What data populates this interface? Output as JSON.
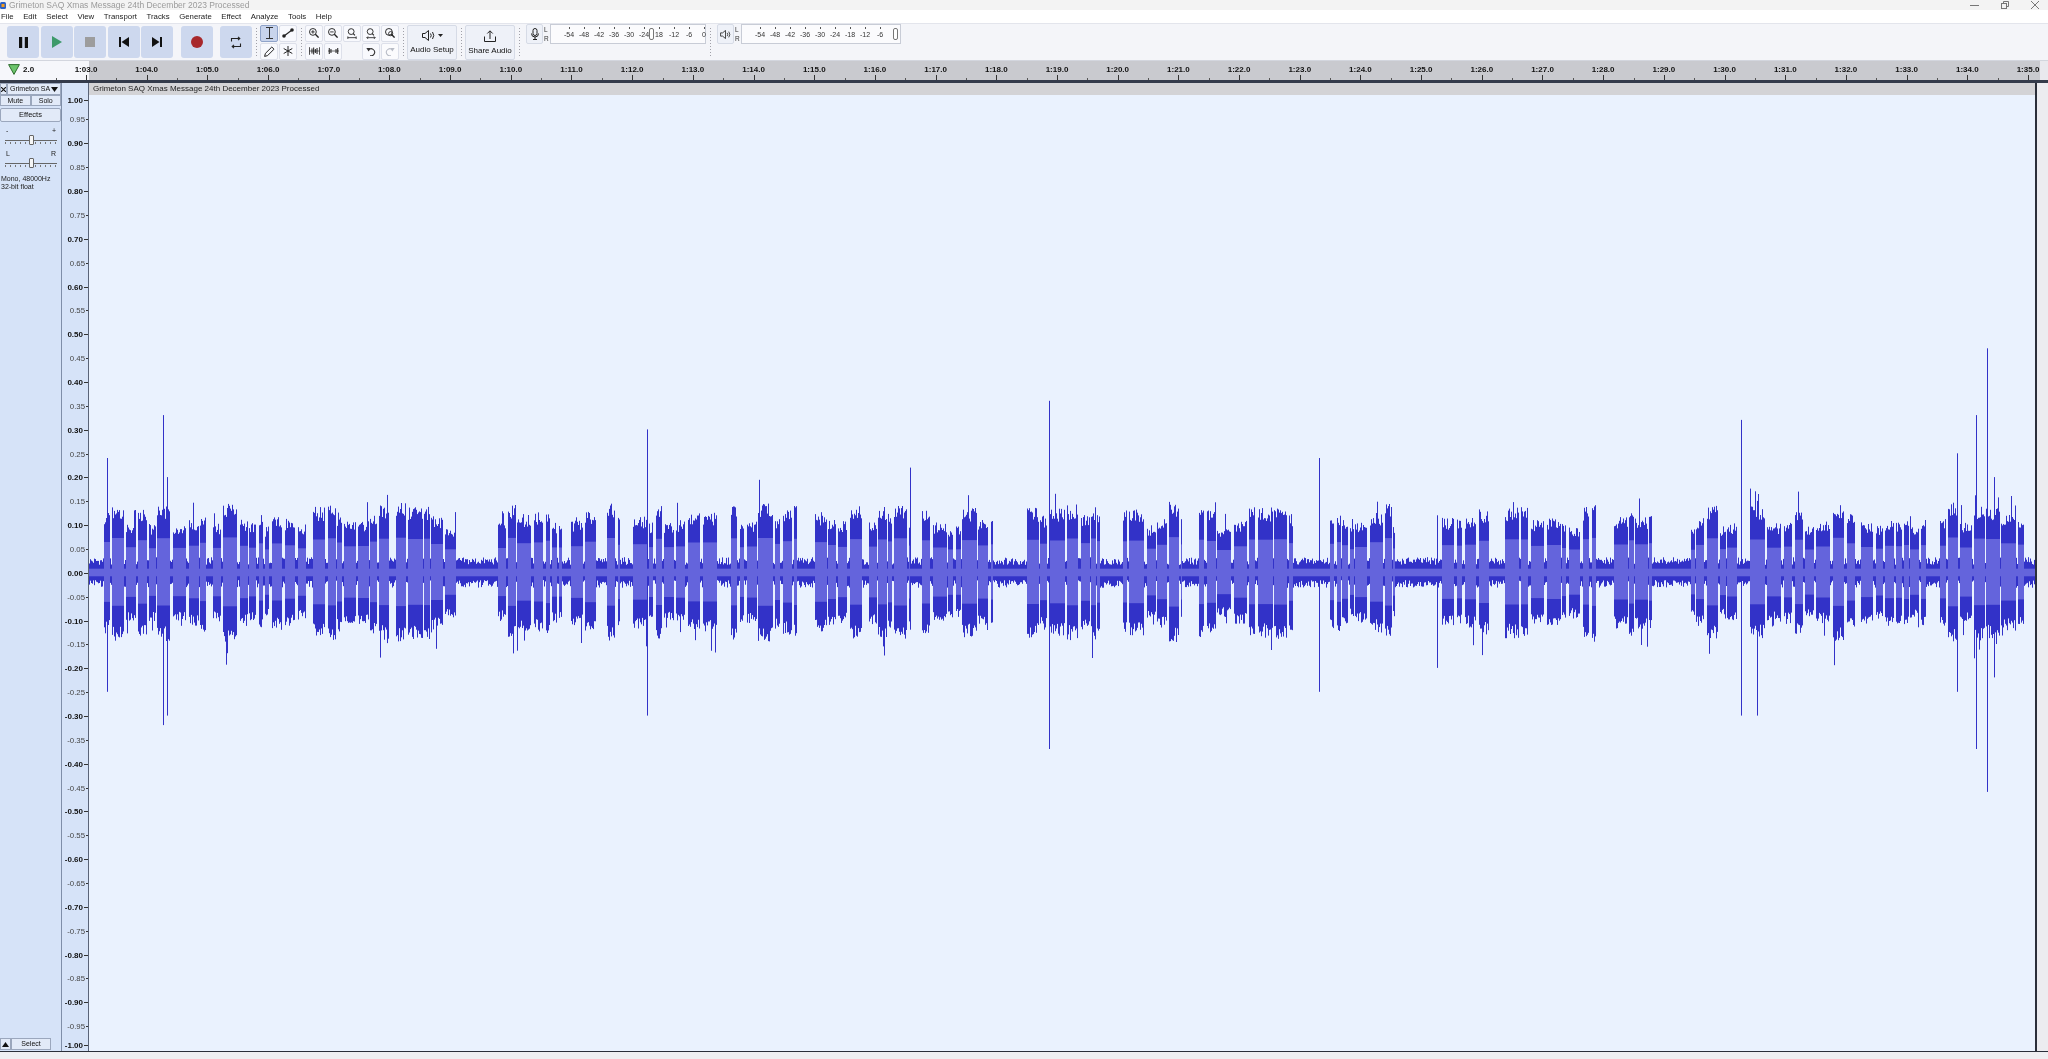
{
  "window": {
    "title": "Grimeton SAQ Xmas Message 24th December 2023 Processed"
  },
  "menu": [
    "File",
    "Edit",
    "Select",
    "View",
    "Transport",
    "Tracks",
    "Generate",
    "Effect",
    "Analyze",
    "Tools",
    "Help"
  ],
  "transport": [
    {
      "kind": "pause"
    },
    {
      "kind": "play"
    },
    {
      "kind": "stop"
    },
    {
      "kind": "skip_start"
    },
    {
      "kind": "skip_end"
    },
    {
      "kind": "record"
    },
    {
      "kind": "loop"
    }
  ],
  "tools": [
    {
      "kind": "select",
      "selected": true
    },
    {
      "kind": "envelope",
      "selected": false
    },
    {
      "kind": "draw",
      "selected": false
    },
    {
      "kind": "multi",
      "selected": false
    }
  ],
  "zoom_tools": [
    {
      "kind": "zoom_in"
    },
    {
      "kind": "zoom_out"
    },
    {
      "kind": "fit_selection"
    },
    {
      "kind": "fit_project"
    },
    {
      "kind": "zoom_toggle"
    }
  ],
  "edit_tools": [
    {
      "kind": "trim"
    },
    {
      "kind": "silence"
    }
  ],
  "history": [
    {
      "kind": "undo",
      "disabled": false
    },
    {
      "kind": "redo",
      "disabled": true
    }
  ],
  "audio_setup": {
    "label": "Audio Setup"
  },
  "share_audio": {
    "label": "Share Audio"
  },
  "recording_meter": {
    "channels": [
      "L",
      "R"
    ],
    "scale": [
      "-54",
      "-48",
      "-42",
      "-36",
      "-30",
      "-24",
      "18",
      "-12",
      "-6",
      "0"
    ],
    "level": 0.65
  },
  "playback_meter": {
    "channels": [
      "L",
      "R"
    ],
    "scale": [
      "-54",
      "-48",
      "-42",
      "-36",
      "-30",
      "-24",
      "-18",
      "-12",
      "-6"
    ],
    "level": 1.0
  },
  "timeline": {
    "labels": [
      "2.0",
      "1:03.0",
      "1:04.0",
      "1:05.0",
      "1:06.0",
      "1:07.0",
      "1:08.0",
      "1:09.0",
      "1:10.0",
      "1:11.0",
      "1:12.0",
      "1:13.0",
      "1:14.0",
      "1:15.0",
      "1:16.0",
      "1:17.0",
      "1:18.0",
      "1:19.0",
      "1:20.0",
      "1:21.0",
      "1:22.0",
      "1:23.0",
      "1:24.0",
      "1:25.0",
      "1:26.0",
      "1:27.0",
      "1:28.0",
      "1:29.0",
      "1:30.0",
      "1:31.0",
      "1:32.0",
      "1:33.0",
      "1:34.0",
      "1:35.0"
    ]
  },
  "track": {
    "name": "Grimeton SA",
    "mute": {
      "label": "Mute",
      "on": false
    },
    "solo": {
      "label": "Solo",
      "on": false
    },
    "effects": "Effects",
    "gain": {
      "min_label": "-",
      "max_label": "+",
      "level": 0.5
    },
    "pan": {
      "left_label": "L",
      "right_label": "R",
      "level": 0.5
    },
    "format": "Mono, 48000Hz",
    "sample_format": "32-bit float",
    "select": "Select"
  },
  "vertical_ruler": [
    "1.00",
    "0.95",
    "0.90",
    "0.85",
    "0.80",
    "0.75",
    "0.70",
    "0.65",
    "0.60",
    "0.55",
    "0.50",
    "0.45",
    "0.40",
    "0.35",
    "0.30",
    "0.25",
    "0.20",
    "0.15",
    "0.10",
    "0.05",
    "0.00",
    "-0.05",
    "-0.10",
    "-0.15",
    "-0.20",
    "-0.25",
    "-0.30",
    "-0.35",
    "-0.40",
    "-0.45",
    "-0.50",
    "-0.55",
    "-0.60",
    "-0.65",
    "-0.70",
    "-0.75",
    "-0.80",
    "-0.85",
    "-0.90",
    "-0.95",
    "-1.00"
  ],
  "clip": {
    "title": "Grimeton SAQ Xmas Message 24th December 2023 Processed"
  }
}
